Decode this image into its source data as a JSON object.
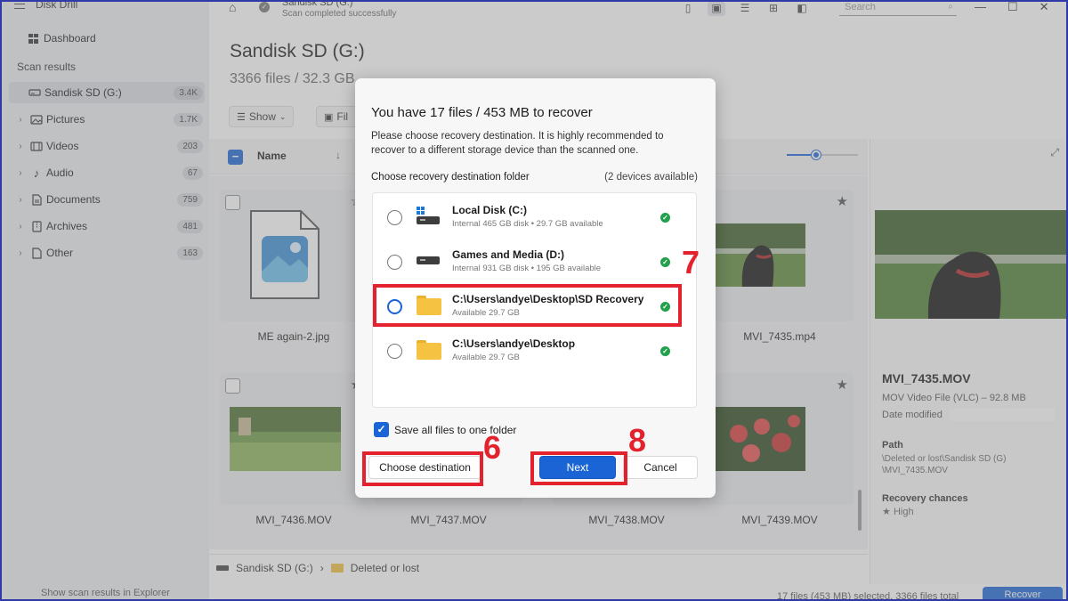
{
  "app": {
    "title": "Disk Drill"
  },
  "sidebar": {
    "dashboard": "Dashboard",
    "section": "Scan results",
    "items": [
      {
        "label": "Sandisk SD (G:)",
        "count": "3.4K",
        "icon": "drive-icon"
      },
      {
        "label": "Pictures",
        "count": "1.7K",
        "icon": "picture-icon"
      },
      {
        "label": "Videos",
        "count": "203",
        "icon": "video-icon"
      },
      {
        "label": "Audio",
        "count": "67",
        "icon": "music-note-icon"
      },
      {
        "label": "Documents",
        "count": "759",
        "icon": "document-icon"
      },
      {
        "label": "Archives",
        "count": "481",
        "icon": "archive-icon"
      },
      {
        "label": "Other",
        "count": "163",
        "icon": "file-icon"
      }
    ],
    "footer": "Show scan results in Explorer"
  },
  "header": {
    "crumb_title": "Sandisk SD (G:)",
    "crumb_sub": "Scan completed successfully",
    "search_placeholder": "Search",
    "page_title": "Sandisk SD (G:)",
    "page_sub": "3366 files / 32.3 GB",
    "show_label": "Show",
    "filter_label": "Fil"
  },
  "list": {
    "name_col": "Name",
    "cards": [
      {
        "name": "ME again-2.jpg"
      },
      {
        "name": "MVI_7435.mp4"
      },
      {
        "name": "MVI_7436.MOV"
      },
      {
        "name": "MVI_7437.MOV"
      },
      {
        "name": "MVI_7438.MOV"
      },
      {
        "name": "MVI_7439.MOV"
      }
    ]
  },
  "statusbar": {
    "drive": "Sandisk SD (G:)",
    "folder": "Deleted or lost",
    "summary": "17 files (453 MB) selected, 3366 files total",
    "recover": "Recover"
  },
  "preview": {
    "title": "MVI_7435.MOV",
    "type": "MOV Video File (VLC) – 92.8 MB",
    "date_label": "Date modified",
    "path_label": "Path",
    "path_line1": "\\Deleted or lost\\Sandisk SD (G)",
    "path_line2": "\\MVI_7435.MOV",
    "chances_label": "Recovery chances",
    "chances_value": "High"
  },
  "dialog": {
    "title": "You have 17 files / 453 MB to recover",
    "desc": "Please choose recovery destination. It is highly recommended to recover to a different storage device than the scanned one.",
    "folder_label": "Choose recovery destination folder",
    "devices": "(2 devices available)",
    "destinations": [
      {
        "name": "Local Disk (C:)",
        "sub": "Internal 465 GB disk • 29.7 GB available"
      },
      {
        "name": "Games and Media (D:)",
        "sub": "Internal 931 GB disk • 195 GB available"
      },
      {
        "name": "C:\\Users\\andye\\Desktop\\SD Recovery",
        "sub": "Available 29.7 GB"
      },
      {
        "name": "C:\\Users\\andye\\Desktop",
        "sub": "Available 29.7 GB"
      }
    ],
    "save_all": "Save all files to one folder",
    "choose_btn": "Choose destination",
    "next_btn": "Next",
    "cancel_btn": "Cancel"
  },
  "annotations": {
    "n6": "6",
    "n7": "7",
    "n8": "8"
  },
  "colors": {
    "accent": "#1a64d6",
    "annotation": "#e3222d",
    "ok": "#22a04b"
  }
}
